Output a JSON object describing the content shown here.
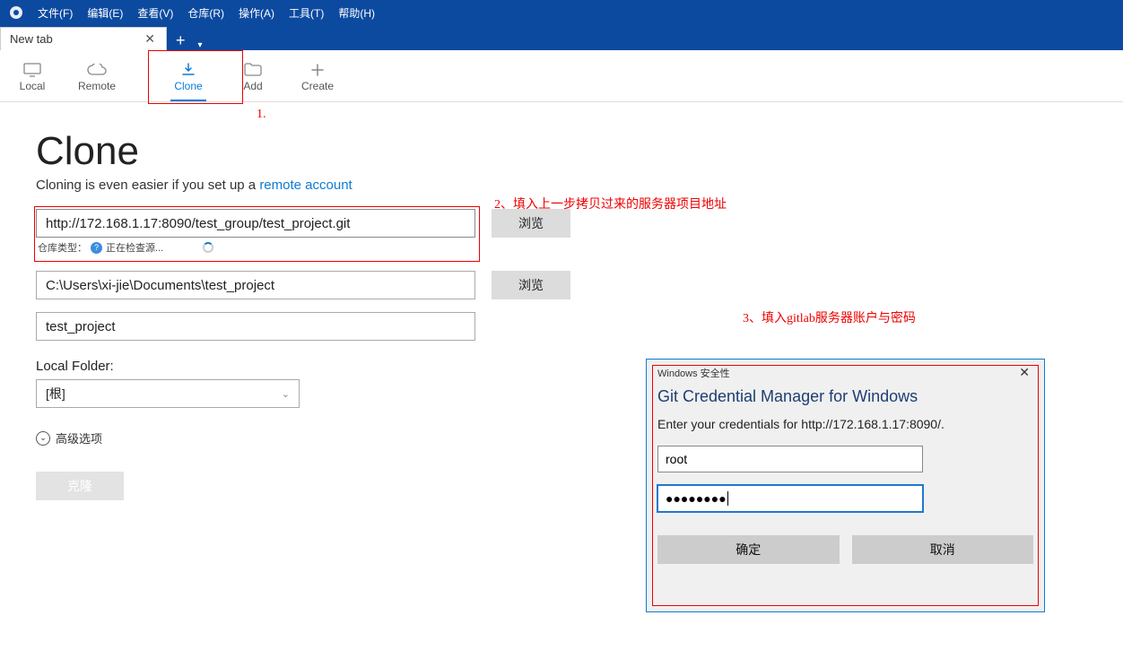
{
  "menubar": {
    "items": [
      "文件(F)",
      "编辑(E)",
      "查看(V)",
      "仓库(R)",
      "操作(A)",
      "工具(T)",
      "帮助(H)"
    ]
  },
  "tab": {
    "label": "New tab"
  },
  "toolbar": {
    "local": "Local",
    "remote": "Remote",
    "clone": "Clone",
    "add": "Add",
    "create": "Create"
  },
  "page": {
    "title": "Clone",
    "subtitle_pre": "Cloning is even easier if you set up a ",
    "subtitle_link": "remote account"
  },
  "form": {
    "source_url": "http://172.168.1.17:8090/test_group/test_project.git",
    "browse": "浏览",
    "repo_type_label": "仓库类型：",
    "checking": "正在检查源...",
    "dest_path": "C:\\Users\\xi-jie\\Documents\\test_project",
    "project_name": "test_project",
    "local_folder_label": "Local Folder:",
    "local_folder_value": "[根]",
    "advanced": "高级选项",
    "clone_btn": "克隆"
  },
  "annotations": {
    "a1": "1.",
    "a2": "2、填入上一步拷贝过来的服务器项目地址",
    "a3": "3、填入gitlab服务器账户与密码"
  },
  "dialog": {
    "small_title": "Windows 安全性",
    "title": "Git Credential Manager for Windows",
    "subtitle": "Enter your credentials for http://172.168.1.17:8090/.",
    "username": "root",
    "password_display": "●●●●●●●●",
    "ok": "确定",
    "cancel": "取消"
  }
}
